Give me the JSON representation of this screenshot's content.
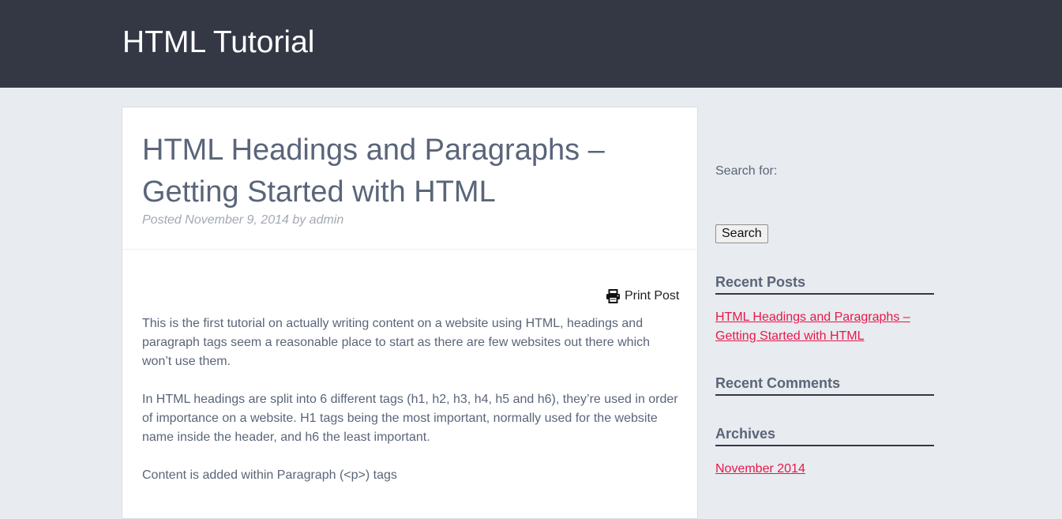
{
  "header": {
    "site_title": "HTML Tutorial"
  },
  "post": {
    "title": "HTML Headings and Paragraphs – Getting Started with HTML",
    "meta": "Posted November 9, 2014 by admin",
    "print_label": "Print Post",
    "paragraphs": [
      "This is the first tutorial on actually writing content on a website using HTML, headings and paragraph tags seem a reasonable place to start as there are few websites out there which won’t use them.",
      "In HTML headings are split into 6 different tags (h1, h2, h3, h4, h5 and h6), they’re used in order of importance on a website. H1 tags being the most important, normally used for the website name inside the header, and h6 the least important.",
      "Content is added within Paragraph (<p>) tags"
    ]
  },
  "sidebar": {
    "search": {
      "label": "Search for:",
      "button_label": "Search"
    },
    "recent_posts": {
      "title": "Recent Posts",
      "items": [
        "HTML Headings and Paragraphs – Getting Started with HTML"
      ]
    },
    "recent_comments": {
      "title": "Recent Comments"
    },
    "archives": {
      "title": "Archives",
      "items": [
        "November 2014"
      ]
    }
  },
  "colors": {
    "header_bg": "#333844",
    "page_bg": "#e8ebef",
    "text": "#5a6579",
    "link": "#e8174b"
  },
  "icons": {
    "print": "printer-icon"
  }
}
